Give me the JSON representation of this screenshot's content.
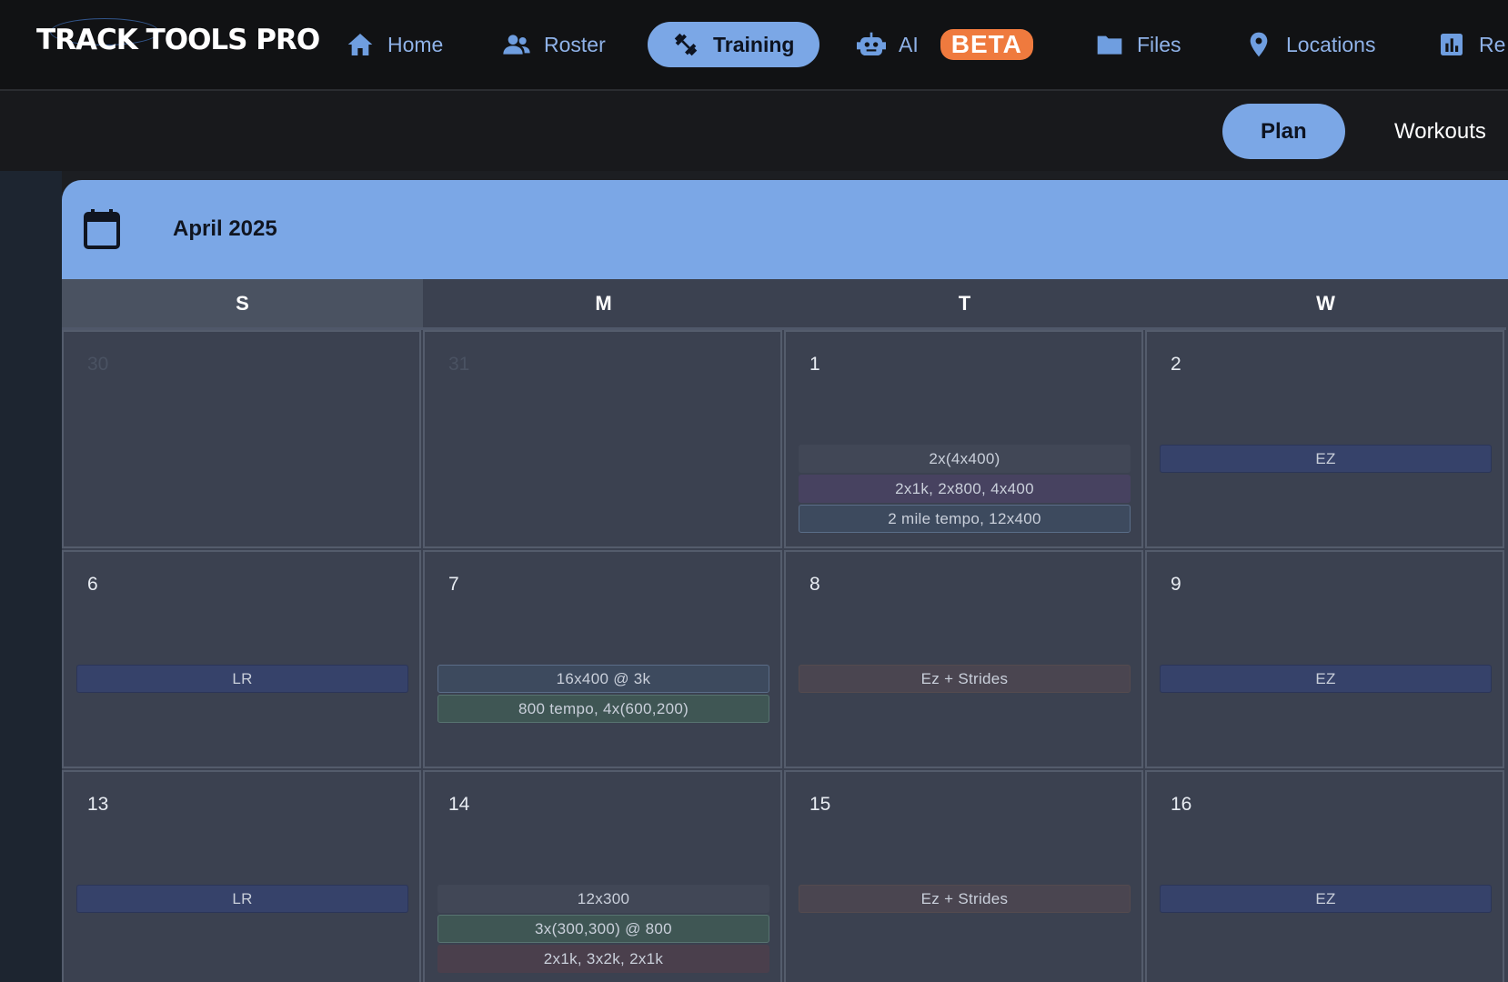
{
  "app": {
    "logo": "TRACK TOOLS PRO"
  },
  "nav": {
    "items": [
      {
        "label": "Home",
        "icon": "home-icon"
      },
      {
        "label": "Roster",
        "icon": "people-icon"
      },
      {
        "label": "Training",
        "icon": "dumbbell-icon",
        "active": true
      },
      {
        "label": "AI",
        "icon": "robot-icon",
        "badge": "BETA"
      },
      {
        "label": "Files",
        "icon": "folder-icon"
      },
      {
        "label": "Locations",
        "icon": "location-pin-icon"
      },
      {
        "label": "Re",
        "icon": "bar-chart-icon"
      }
    ]
  },
  "subnav": {
    "plan": "Plan",
    "workouts": "Workouts"
  },
  "calendar": {
    "month": "April 2025",
    "days_of_week": [
      "S",
      "M",
      "T",
      "W"
    ],
    "weeks": [
      [
        {
          "day": "30",
          "muted": true,
          "events": []
        },
        {
          "day": "31",
          "muted": true,
          "events": []
        },
        {
          "day": "1",
          "events": [
            {
              "label": "2x(4x400)",
              "style": "gray"
            },
            {
              "label": "2x1k, 2x800, 4x400",
              "style": "purple"
            },
            {
              "label": "2 mile tempo, 12x400",
              "style": "blue"
            }
          ]
        },
        {
          "day": "2",
          "events": [
            {
              "label": "EZ",
              "style": "navy"
            }
          ]
        }
      ],
      [
        {
          "day": "6",
          "events": [
            {
              "label": "LR",
              "style": "navy"
            }
          ]
        },
        {
          "day": "7",
          "events": [
            {
              "label": "16x400 @ 3k",
              "style": "blue"
            },
            {
              "label": "800 tempo, 4x(600,200)",
              "style": "green"
            }
          ]
        },
        {
          "day": "8",
          "events": [
            {
              "label": "Ez + Strides",
              "style": "brown"
            }
          ]
        },
        {
          "day": "9",
          "events": [
            {
              "label": "EZ",
              "style": "navy"
            }
          ]
        }
      ],
      [
        {
          "day": "13",
          "events": [
            {
              "label": "LR",
              "style": "navy"
            }
          ]
        },
        {
          "day": "14",
          "events": [
            {
              "label": "12x300",
              "style": "gray"
            },
            {
              "label": "3x(300,300) @ 800",
              "style": "green"
            },
            {
              "label": "2x1k, 3x2k, 2x1k",
              "style": "red"
            }
          ]
        },
        {
          "day": "15",
          "events": [
            {
              "label": "Ez + Strides",
              "style": "brown"
            }
          ]
        },
        {
          "day": "16",
          "events": [
            {
              "label": "EZ",
              "style": "navy"
            }
          ]
        }
      ]
    ]
  }
}
